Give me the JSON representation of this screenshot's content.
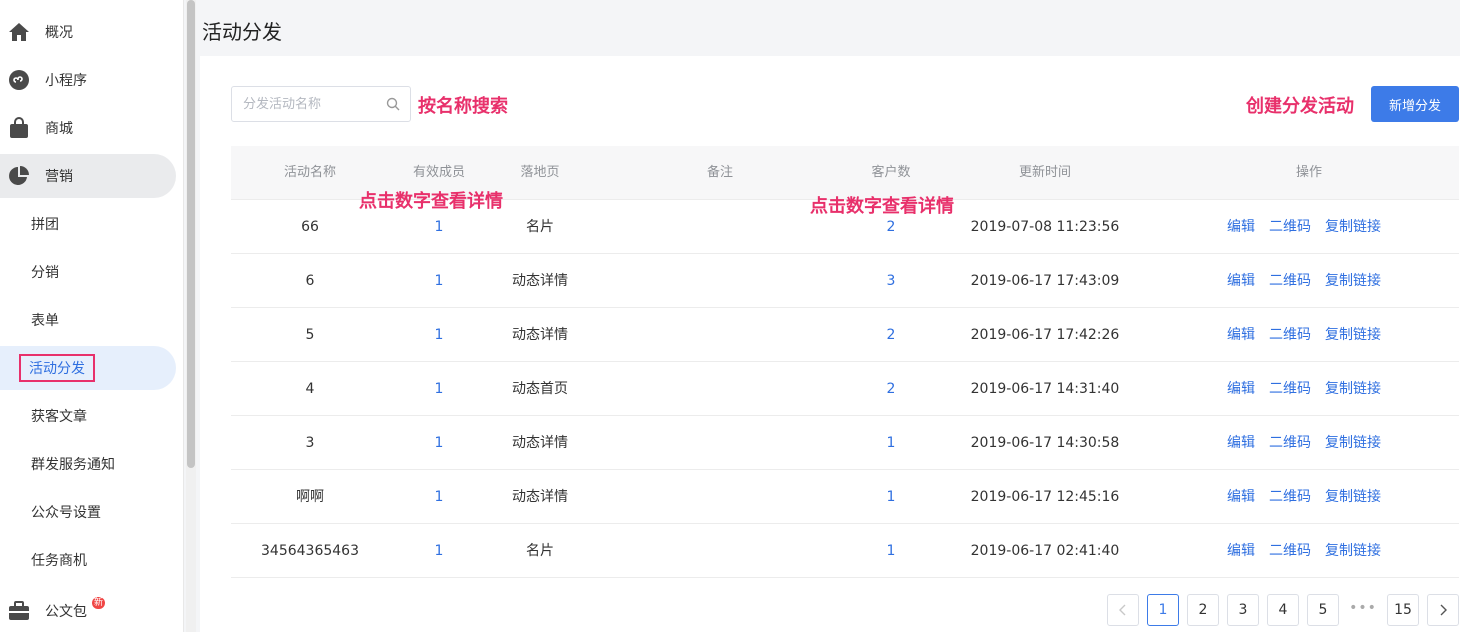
{
  "page_title": "活动分发",
  "sidebar": {
    "top_items": [
      {
        "label": "概况",
        "icon": "home-icon"
      },
      {
        "label": "小程序",
        "icon": "mini-program-icon"
      },
      {
        "label": "商城",
        "icon": "shopping-bag-icon"
      },
      {
        "label": "营销",
        "icon": "pie-chart-icon"
      }
    ],
    "sub_items": [
      {
        "label": "拼团"
      },
      {
        "label": "分销"
      },
      {
        "label": "表单"
      },
      {
        "label": "活动分发"
      },
      {
        "label": "获客文章"
      },
      {
        "label": "群发服务通知"
      },
      {
        "label": "公众号设置"
      },
      {
        "label": "任务商机"
      }
    ],
    "bottom_item": {
      "label": "公文包",
      "icon": "briefcase-icon",
      "badge": "新"
    }
  },
  "search": {
    "placeholder": "分发活动名称",
    "value": ""
  },
  "annotations": {
    "search_hint": "按名称搜索",
    "create_hint": "创建分发活动",
    "members_hint": "点击数字查看详情",
    "customers_hint": "点击数字查看详情"
  },
  "toolbar": {
    "add_label": "新增分发"
  },
  "table": {
    "headers": [
      "活动名称",
      "有效成员",
      "落地页",
      "备注",
      "客户数",
      "更新时间",
      "操作"
    ],
    "rows": [
      {
        "name": "66",
        "members": "1",
        "landing": "名片",
        "note": "",
        "customers": "2",
        "updated": "2019-07-08 11:23:56"
      },
      {
        "name": "6",
        "members": "1",
        "landing": "动态详情",
        "note": "",
        "customers": "3",
        "updated": "2019-06-17 17:43:09"
      },
      {
        "name": "5",
        "members": "1",
        "landing": "动态详情",
        "note": "",
        "customers": "2",
        "updated": "2019-06-17 17:42:26"
      },
      {
        "name": "4",
        "members": "1",
        "landing": "动态首页",
        "note": "",
        "customers": "2",
        "updated": "2019-06-17 14:31:40"
      },
      {
        "name": "3",
        "members": "1",
        "landing": "动态详情",
        "note": "",
        "customers": "1",
        "updated": "2019-06-17 14:30:58"
      },
      {
        "name": "啊啊",
        "members": "1",
        "landing": "动态详情",
        "note": "",
        "customers": "1",
        "updated": "2019-06-17 12:45:16"
      },
      {
        "name": "34564365463",
        "members": "1",
        "landing": "名片",
        "note": "",
        "customers": "1",
        "updated": "2019-06-17 02:41:40"
      }
    ],
    "actions": [
      "编辑",
      "二维码",
      "复制链接"
    ]
  },
  "pagination": {
    "pages": [
      "1",
      "2",
      "3",
      "4",
      "5"
    ],
    "ellipsis": "•••",
    "last": "15",
    "current": "1"
  },
  "colors": {
    "accent": "#3d7be8",
    "annotation": "#e8306b",
    "link": "#2f6fe0"
  }
}
